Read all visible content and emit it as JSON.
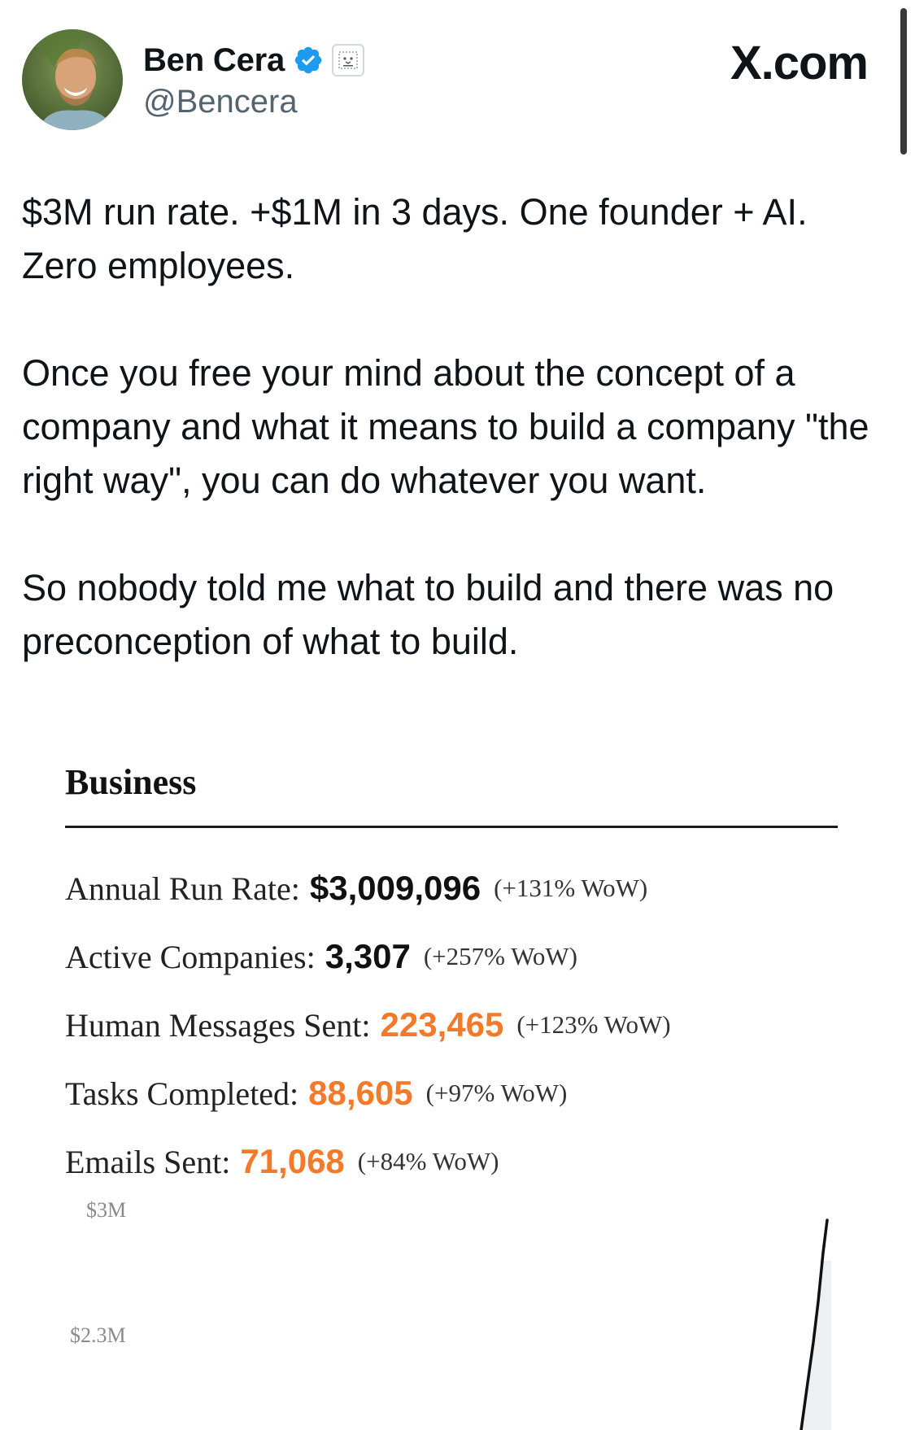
{
  "author": {
    "display_name": "Ben Cera",
    "handle": "@Bencera",
    "verified": true
  },
  "source": "X.com",
  "tweet": {
    "paragraphs": [
      "$3M run rate. +$1M in 3 days. One founder + AI. Zero employees.",
      "Once you free your mind about the concept of a company and what it means to build a company \"the right way\", you can do whatever you want.",
      "So nobody told me what to build and there was no preconception of what to build."
    ]
  },
  "media": {
    "section_title": "Business",
    "metrics": [
      {
        "label": "Annual Run Rate:",
        "value": "$3,009,096",
        "change": "(+131% WoW)",
        "value_color": "#111111"
      },
      {
        "label": "Active Companies:",
        "value": "3,307",
        "change": "(+257% WoW)",
        "value_color": "#111111"
      },
      {
        "label": "Human Messages Sent:",
        "value": "223,465",
        "change": "(+123% WoW)",
        "value_color": "#f47a2a"
      },
      {
        "label": "Tasks Completed:",
        "value": "88,605",
        "change": "(+97% WoW)",
        "value_color": "#f47a2a"
      },
      {
        "label": "Emails Sent:",
        "value": "71,068",
        "change": "(+84% WoW)",
        "value_color": "#f47a2a"
      }
    ],
    "chart_data": {
      "type": "line",
      "y_tick_labels": [
        "$3M",
        "$2.3M"
      ],
      "series": [
        {
          "points_visible": "steep rise near right edge"
        }
      ]
    }
  },
  "colors": {
    "verified_blue": "#1d9bf0",
    "accent_orange": "#f47a2a",
    "text_primary": "#0f1419",
    "text_secondary": "#536471"
  }
}
